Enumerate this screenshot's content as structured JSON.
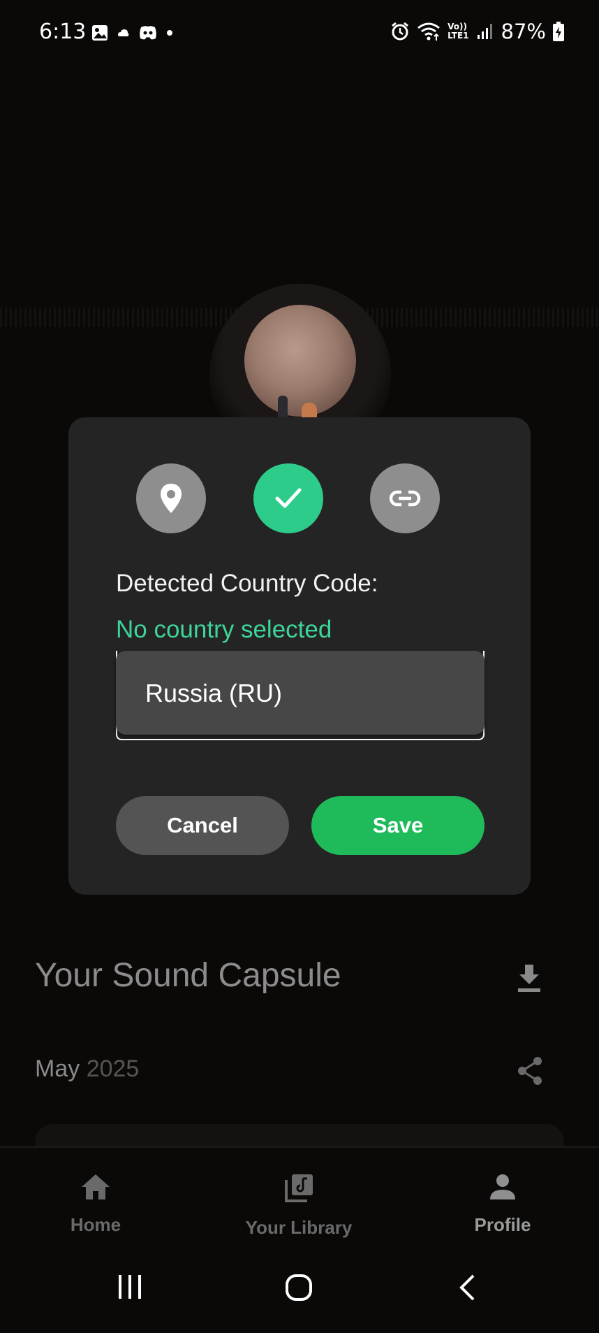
{
  "status_bar": {
    "time": "6:13",
    "battery": "87%",
    "left_icons": [
      "gallery-icon",
      "cloud-icon",
      "discord-icon",
      "dot-icon"
    ],
    "right_icons": [
      "alarm-icon",
      "wifi-icon",
      "volte-icon",
      "signal-icon",
      "battery-icon"
    ],
    "volte_label_top": "Vo))",
    "volte_label_bottom": "LTE1"
  },
  "background": {
    "capsule_title": "Your Sound Capsule",
    "month": "May",
    "year": "2025"
  },
  "dialog": {
    "steps": [
      {
        "icon": "location-pin-icon",
        "state": "inactive"
      },
      {
        "icon": "checkmark-icon",
        "state": "active"
      },
      {
        "icon": "link-icon",
        "state": "inactive"
      }
    ],
    "detected_label": "Detected Country Code:",
    "detected_value": "No country selected",
    "selected_country": "Russia (RU)",
    "cancel_label": "Cancel",
    "save_label": "Save"
  },
  "bottom_nav": {
    "items": [
      {
        "label": "Home",
        "icon": "home-icon"
      },
      {
        "label": "Your Library",
        "icon": "library-icon"
      },
      {
        "label": "Profile",
        "icon": "profile-icon",
        "active": true
      }
    ]
  },
  "colors": {
    "accent_green": "#1fba5a",
    "mint_green": "#2ecc8a",
    "dialog_bg": "#242424"
  }
}
